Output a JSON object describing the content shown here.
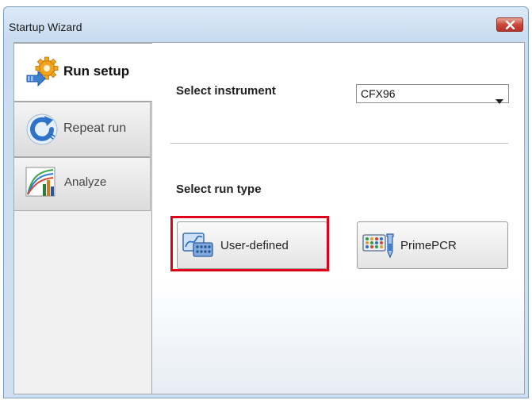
{
  "window": {
    "title": "Startup Wizard",
    "close_icon": "close-icon"
  },
  "tabs": [
    {
      "label": "Run setup",
      "icon": "gear-arrow-icon",
      "active": true
    },
    {
      "label": "Repeat run",
      "icon": "refresh-icon",
      "active": false
    },
    {
      "label": "Analyze",
      "icon": "chart-icon",
      "active": false
    }
  ],
  "run_setup": {
    "instrument_label": "Select instrument",
    "instrument_value": "CFX96",
    "run_type_label": "Select run type",
    "user_defined_label": "User-defined",
    "primepcr_label": "PrimePCR"
  },
  "colors": {
    "highlight": "#e0001a",
    "close_button": "#c9483a"
  }
}
